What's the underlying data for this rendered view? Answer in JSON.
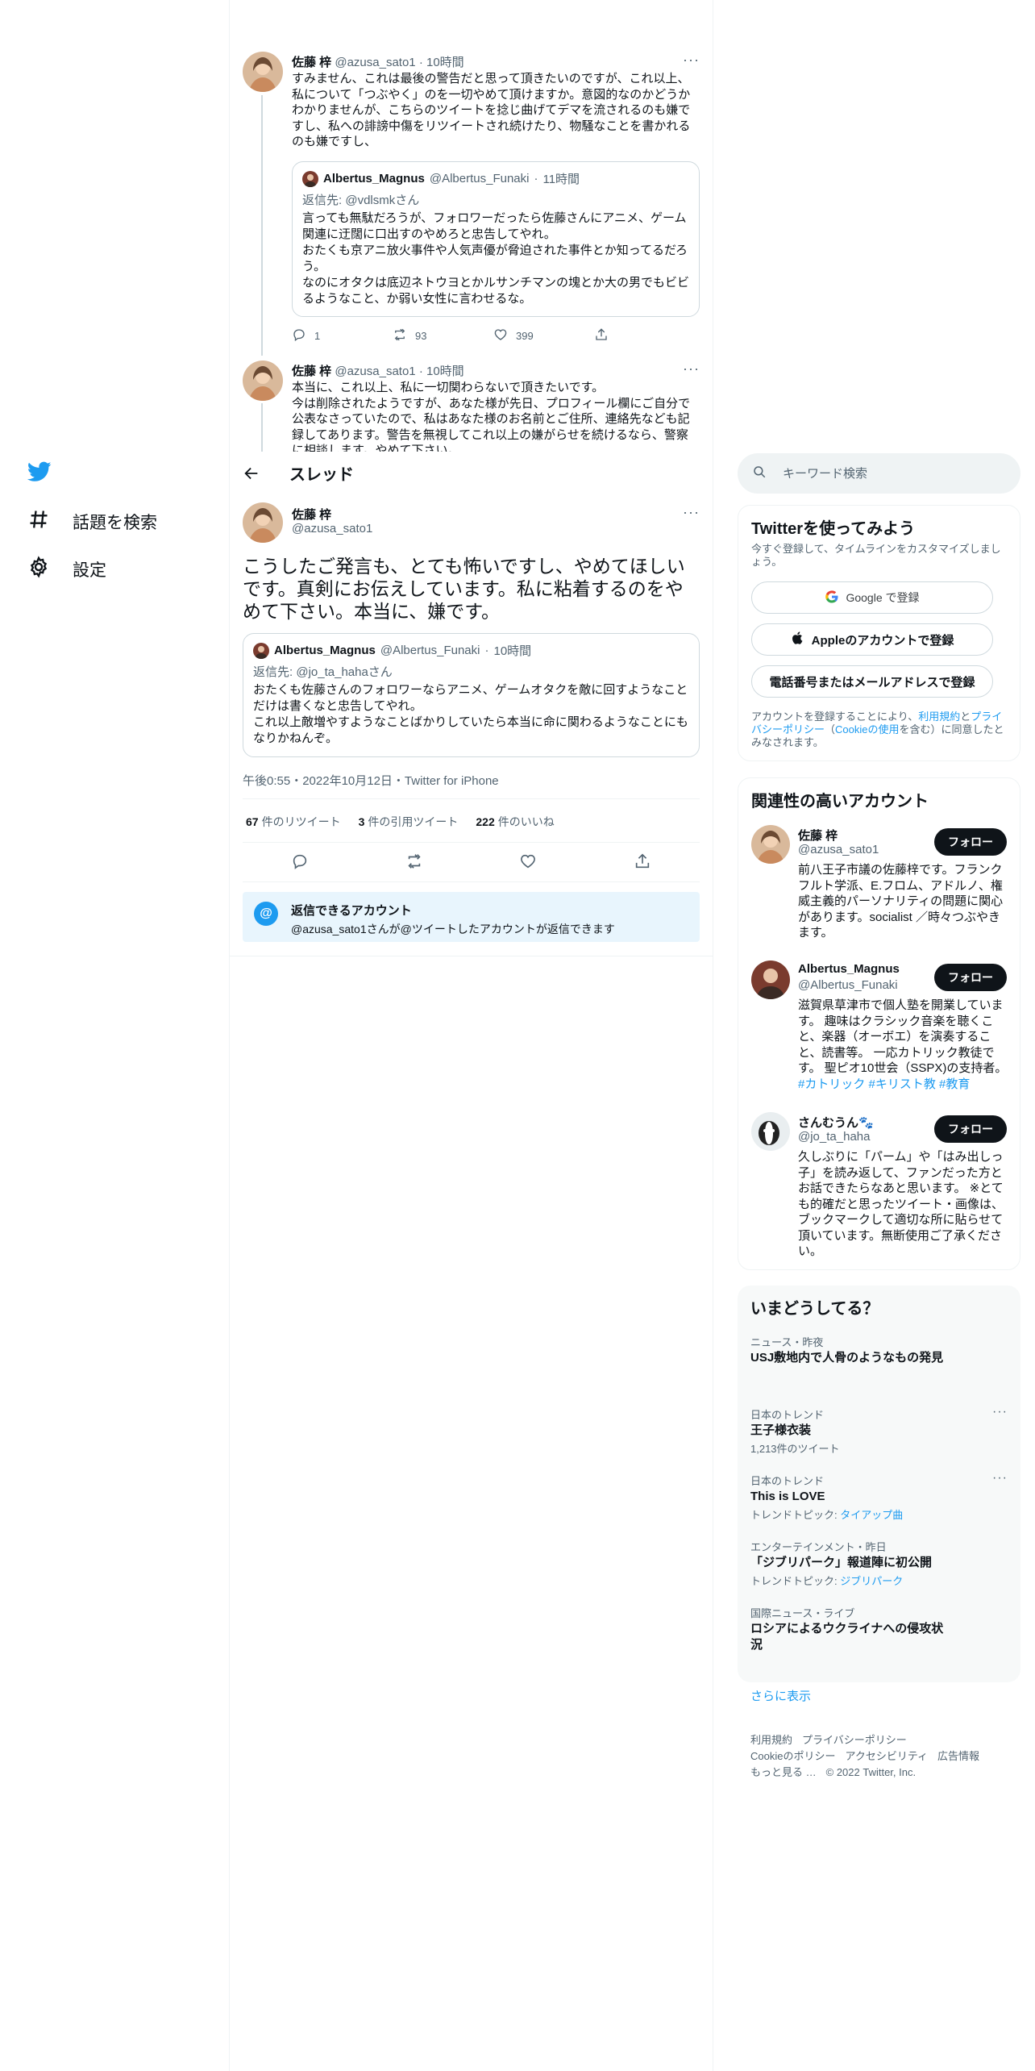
{
  "colors": {
    "accent": "#1d9bf0",
    "text": "#0f1419",
    "secondary": "#536471",
    "border": "#eff3f4"
  },
  "nav": {
    "items": [
      {
        "label": "話題を検索",
        "icon": "hashtag-icon"
      },
      {
        "label": "設定",
        "icon": "gear-icon"
      }
    ]
  },
  "thread_header": {
    "title": "スレッド"
  },
  "prev_tweets": [
    {
      "name": "佐藤 梓",
      "handle": "@azusa_sato1",
      "time": "10時間",
      "text": "すみません、これは最後の警告だと思って頂きたいのですが、これ以上、私について「つぶやく」のを一切やめて頂けますか。意図的なのかどうかわかりませんが、こちらのツイートを捻じ曲げてデマを流されるのも嫌ですし、私への誹謗中傷をリツイートされ続けたり、物騒なことを書かれるのも嫌ですし、",
      "quote": {
        "name": "Albertus_Magnus",
        "handle": "@Albertus_Funaki",
        "time": "11時間",
        "reply_to_prefix": "返信先: ",
        "reply_to": "@vdlsmkさん",
        "text": "言っても無駄だろうが、フォロワーだったら佐藤さんにアニメ、ゲーム関連に迂闊に口出すのやめろと忠告してやれ。\nおたくも京アニ放火事件や人気声優が脅迫された事件とか知ってるだろう。\nなのにオタクは底辺ネトウヨとかルサンチマンの塊とか大の男でもビビるようなこと、か弱い女性に言わせるな。"
      },
      "replies": "1",
      "retweets": "93",
      "likes": "399"
    },
    {
      "name": "佐藤 梓",
      "handle": "@azusa_sato1",
      "time": "10時間",
      "text": "本当に、これ以上、私に一切関わらないで頂きたいです。\n今は削除されたようですが、あなた様が先日、プロフィール欄にご自分で公表なさっていたので、私はあなた様のお名前とご住所、連絡先なども記録してあります。警告を無視してこれ以上の嫌がらせを続けるなら、警察に相談します。やめて下さい。"
    }
  ],
  "main_tweet": {
    "name": "佐藤 梓",
    "handle": "@azusa_sato1",
    "text": "こうしたご発言も、とても怖いですし、やめてほしいです。真剣にお伝えしています。私に粘着するのをやめて下さい。本当に、嫌です。",
    "quote": {
      "name": "Albertus_Magnus",
      "handle": "@Albertus_Funaki",
      "time": "10時間",
      "reply_to_prefix": "返信先: ",
      "reply_to": "@jo_ta_hahaさん",
      "text": "おたくも佐藤さんのフォロワーならアニメ、ゲームオタクを敵に回すようなことだけは書くなと忠告してやれ。\nこれ以上敵増やすようなことばかりしていたら本当に命に関わるようなことにもなりかねんぞ。"
    },
    "timestamp": "午後0:55・2022年10月12日・Twitter for iPhone",
    "retweets": "67",
    "retweets_label": "件のリツイート",
    "quote_tweets": "3",
    "quote_tweets_label": "件の引用ツイート",
    "likes": "222",
    "likes_label": "件のいいね",
    "reply_restriction_title": "返信できるアカウント",
    "reply_restriction_text": "@azusa_sato1さんが@ツイートしたアカウントが返信できます"
  },
  "search": {
    "placeholder": "キーワード検索"
  },
  "signup": {
    "title": "Twitterを使ってみよう",
    "subtitle": "今すぐ登録して、タイムラインをカスタマイズしましょう。",
    "google": "Google で登録",
    "apple": "Appleのアカウントで登録",
    "phone": "電話番号またはメールアドレスで登録",
    "terms_prefix": "アカウントを登録することにより、",
    "terms_link": "利用規約",
    "terms_and": "と",
    "privacy_link": "プライバシーポリシー",
    "cookie_prefix": "（",
    "cookie_link": "Cookieの使用",
    "terms_suffix": "を含む）に同意したとみなされます。"
  },
  "related": {
    "title": "関連性の高いアカウント",
    "follow_label": "フォロー",
    "accounts": [
      {
        "name": "佐藤 梓",
        "handle": "@azusa_sato1",
        "bio": "前八王子市議の佐藤梓です。フランクフルト学派、E.フロム、アドルノ、権威主義的パーソナリティの問題に関心があります。socialist ／時々つぶやきます。"
      },
      {
        "name": "Albertus_Magnus",
        "handle": "@Albertus_Funaki",
        "bio": "滋賀県草津市で個人塾を開業しています。 趣味はクラシック音楽を聴くこと、楽器（オーボエ）を演奏すること、読書等。 一応カトリック教徒です。 聖ピオ10世会（SSPX)の支持者。",
        "tags": "#カトリック #キリスト教 #教育"
      },
      {
        "name": "さんむうん",
        "name_emoji": "🐾",
        "handle": "@jo_ta_haha",
        "bio": "久しぶりに「パーム」や「はみ出しっ子」を読み返して、ファンだった方とお話できたらなあと思います。 ※とても的確だと思ったツイート・画像は、ブックマークして適切な所に貼らせて頂いています。無断使用ご了承ください。"
      }
    ]
  },
  "trends": {
    "title": "いまどうしてる？",
    "items": [
      {
        "category": "ニュース・昨夜",
        "title": "USJ敷地内で人骨のようなもの発見"
      },
      {
        "category": "日本のトレンド",
        "title": "王子様衣装",
        "sub": "1,213件のツイート"
      },
      {
        "category": "日本のトレンド",
        "title": "This is LOVE",
        "sub_prefix": "トレンドトピック: ",
        "sub_link": "タイアップ曲"
      },
      {
        "category": "エンターテインメント・昨日",
        "title": "「ジブリパーク」報道陣に初公開",
        "sub_prefix": "トレンドトピック: ",
        "sub_link": "ジブリパーク"
      },
      {
        "category": "国際ニュース・ライブ",
        "title": "ロシアによるウクライナへの侵攻状況"
      }
    ],
    "show_more": "さらに表示"
  },
  "footer": {
    "links": [
      "利用規約",
      "プライバシーポリシー",
      "Cookieのポリシー",
      "アクセシビリティ",
      "広告情報",
      "もっと見る …"
    ],
    "copyright": "© 2022 Twitter, Inc."
  }
}
